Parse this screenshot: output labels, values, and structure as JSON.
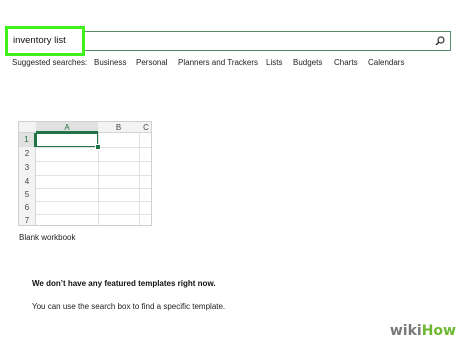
{
  "search": {
    "value": "inventory list",
    "icon": "search-icon",
    "highlight_color": "#3ff21c"
  },
  "suggested": {
    "label": "Suggested searches:",
    "items": [
      "Business",
      "Personal",
      "Planners and Trackers",
      "Lists",
      "Budgets",
      "Charts",
      "Calendars"
    ]
  },
  "template": {
    "columns": [
      "A",
      "B",
      "C"
    ],
    "rows": [
      "1",
      "2",
      "3",
      "4",
      "5",
      "6",
      "7"
    ],
    "label": "Blank workbook",
    "accent": "#217346"
  },
  "message": {
    "title": "We don’t have any featured templates right now.",
    "subtitle": "You can use the search box to find a specific template."
  },
  "watermark": {
    "wiki": "wiki",
    "how": "How"
  }
}
